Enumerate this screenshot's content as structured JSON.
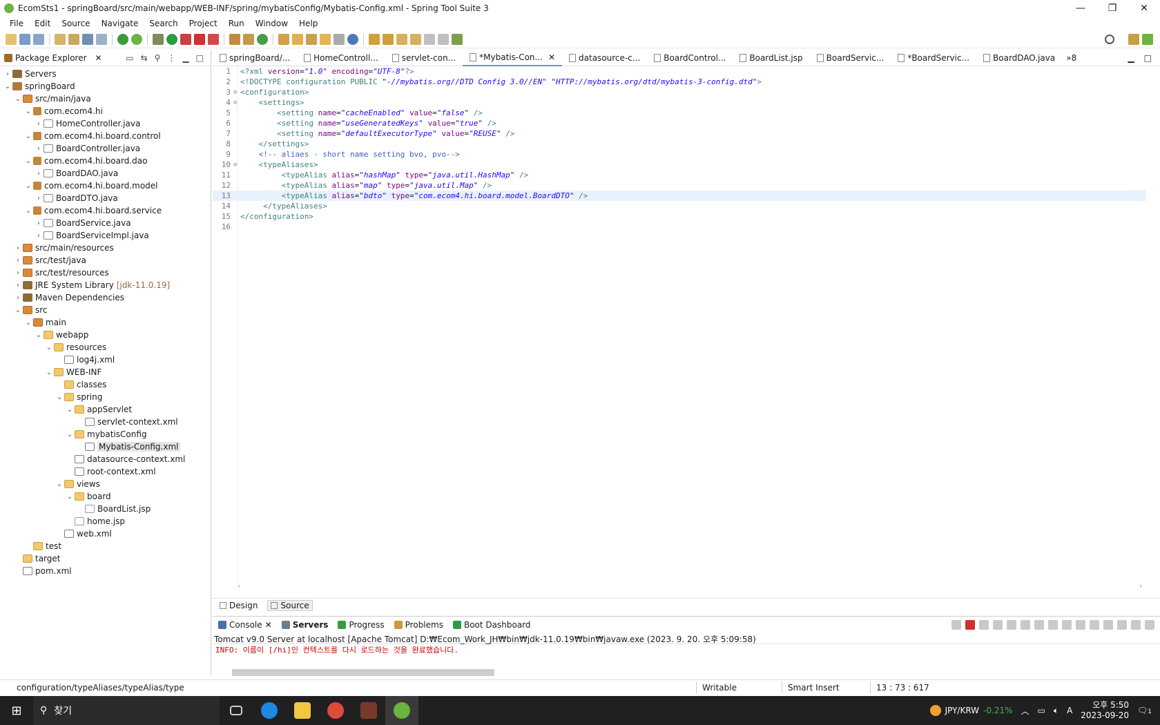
{
  "window": {
    "title": "EcomSts1 - springBoard/src/main/webapp/WEB-INF/spring/mybatisConfig/Mybatis-Config.xml - Spring Tool Suite 3"
  },
  "menu": [
    "File",
    "Edit",
    "Source",
    "Navigate",
    "Search",
    "Project",
    "Run",
    "Window",
    "Help"
  ],
  "package_explorer": {
    "title": "Package Explorer",
    "tree": [
      {
        "label": "Servers",
        "depth": 0,
        "arrow": "›",
        "icon": "server"
      },
      {
        "label": "springBoard",
        "depth": 0,
        "arrow": "⌄",
        "icon": "project"
      },
      {
        "label": "src/main/java",
        "depth": 1,
        "arrow": "⌄",
        "icon": "src"
      },
      {
        "label": "com.ecom4.hi",
        "depth": 2,
        "arrow": "⌄",
        "icon": "pkg"
      },
      {
        "label": "HomeController.java",
        "depth": 3,
        "arrow": "›",
        "icon": "java"
      },
      {
        "label": "com.ecom4.hi.board.control",
        "depth": 2,
        "arrow": "⌄",
        "icon": "pkg"
      },
      {
        "label": "BoardController.java",
        "depth": 3,
        "arrow": "›",
        "icon": "java"
      },
      {
        "label": "com.ecom4.hi.board.dao",
        "depth": 2,
        "arrow": "⌄",
        "icon": "pkg"
      },
      {
        "label": "BoardDAO.java",
        "depth": 3,
        "arrow": "›",
        "icon": "java"
      },
      {
        "label": "com.ecom4.hi.board.model",
        "depth": 2,
        "arrow": "⌄",
        "icon": "pkg"
      },
      {
        "label": "BoardDTO.java",
        "depth": 3,
        "arrow": "›",
        "icon": "java"
      },
      {
        "label": "com.ecom4.hi.board.service",
        "depth": 2,
        "arrow": "⌄",
        "icon": "pkg"
      },
      {
        "label": "BoardService.java",
        "depth": 3,
        "arrow": "›",
        "icon": "java"
      },
      {
        "label": "BoardServiceImpl.java",
        "depth": 3,
        "arrow": "›",
        "icon": "java"
      },
      {
        "label": "src/main/resources",
        "depth": 1,
        "arrow": "›",
        "icon": "src"
      },
      {
        "label": "src/test/java",
        "depth": 1,
        "arrow": "›",
        "icon": "src"
      },
      {
        "label": "src/test/resources",
        "depth": 1,
        "arrow": "›",
        "icon": "src"
      },
      {
        "label": "JRE System Library",
        "depth": 1,
        "arrow": "›",
        "icon": "lib",
        "suffix": "[jdk-11.0.19]"
      },
      {
        "label": "Maven Dependencies",
        "depth": 1,
        "arrow": "›",
        "icon": "lib"
      },
      {
        "label": "src",
        "depth": 1,
        "arrow": "⌄",
        "icon": "src"
      },
      {
        "label": "main",
        "depth": 2,
        "arrow": "⌄",
        "icon": "src"
      },
      {
        "label": "webapp",
        "depth": 3,
        "arrow": "⌄",
        "icon": "folder"
      },
      {
        "label": "resources",
        "depth": 4,
        "arrow": "⌄",
        "icon": "folder"
      },
      {
        "label": "log4j.xml",
        "depth": 5,
        "arrow": "",
        "icon": "xml"
      },
      {
        "label": "WEB-INF",
        "depth": 4,
        "arrow": "⌄",
        "icon": "folder"
      },
      {
        "label": "classes",
        "depth": 5,
        "arrow": "",
        "icon": "folder"
      },
      {
        "label": "spring",
        "depth": 5,
        "arrow": "⌄",
        "icon": "folder"
      },
      {
        "label": "appServlet",
        "depth": 6,
        "arrow": "⌄",
        "icon": "folder"
      },
      {
        "label": "servlet-context.xml",
        "depth": 7,
        "arrow": "",
        "icon": "xml"
      },
      {
        "label": "mybatisConfig",
        "depth": 6,
        "arrow": "⌄",
        "icon": "folder"
      },
      {
        "label": "Mybatis-Config.xml",
        "depth": 7,
        "arrow": "",
        "icon": "xml",
        "selected": true
      },
      {
        "label": "datasource-context.xml",
        "depth": 6,
        "arrow": "",
        "icon": "xml"
      },
      {
        "label": "root-context.xml",
        "depth": 6,
        "arrow": "",
        "icon": "xml"
      },
      {
        "label": "views",
        "depth": 5,
        "arrow": "⌄",
        "icon": "folder"
      },
      {
        "label": "board",
        "depth": 6,
        "arrow": "⌄",
        "icon": "folder"
      },
      {
        "label": "BoardList.jsp",
        "depth": 7,
        "arrow": "",
        "icon": "jsp"
      },
      {
        "label": "home.jsp",
        "depth": 6,
        "arrow": "",
        "icon": "jsp"
      },
      {
        "label": "web.xml",
        "depth": 5,
        "arrow": "",
        "icon": "xml"
      },
      {
        "label": "test",
        "depth": 2,
        "arrow": "",
        "icon": "folder"
      },
      {
        "label": "target",
        "depth": 1,
        "arrow": "",
        "icon": "folder"
      },
      {
        "label": "pom.xml",
        "depth": 1,
        "arrow": "",
        "icon": "xml"
      }
    ]
  },
  "editor_tabs": [
    {
      "label": "springBoard/...",
      "active": false
    },
    {
      "label": "HomeControll...",
      "active": false
    },
    {
      "label": "servlet-con...",
      "active": false
    },
    {
      "label": "*Mybatis-Con...",
      "active": true
    },
    {
      "label": "datasource-c...",
      "active": false
    },
    {
      "label": "BoardControl...",
      "active": false
    },
    {
      "label": "BoardList.jsp",
      "active": false
    },
    {
      "label": "BoardServic...",
      "active": false
    },
    {
      "label": "*BoardServic...",
      "active": false
    },
    {
      "label": "BoardDAO.java",
      "active": false
    }
  ],
  "editor_more": "»8",
  "code_lines": [
    {
      "n": "1",
      "fold": "",
      "tokens": [
        [
          "t",
          "<?xml "
        ],
        [
          "a",
          "version"
        ],
        [
          "p",
          "="
        ],
        [
          "v",
          "\"1.0\""
        ],
        [
          "p",
          " "
        ],
        [
          "a",
          "encoding"
        ],
        [
          "p",
          "="
        ],
        [
          "v",
          "\"UTF-8\""
        ],
        [
          "t",
          "?>"
        ]
      ]
    },
    {
      "n": "2",
      "fold": "",
      "tokens": [
        [
          "t",
          "<!DOCTYPE configuration PUBLIC "
        ],
        [
          "v",
          "\"-//mybatis.org//DTD Config 3.0//EN\""
        ],
        [
          "p",
          " "
        ],
        [
          "v",
          "\"HTTP://mybatis.org/dtd/mybatis-3-config.dtd\""
        ],
        [
          "t",
          ">"
        ]
      ]
    },
    {
      "n": "3",
      "fold": "⊖",
      "tokens": [
        [
          "t",
          "<configuration>"
        ]
      ]
    },
    {
      "n": "4",
      "fold": "⊖",
      "tokens": [
        [
          "p",
          "    "
        ],
        [
          "t",
          "<settings>"
        ]
      ]
    },
    {
      "n": "5",
      "fold": "",
      "tokens": [
        [
          "p",
          "        "
        ],
        [
          "t",
          "<setting "
        ],
        [
          "a",
          "name"
        ],
        [
          "p",
          "="
        ],
        [
          "v",
          "\"cacheEnabled\""
        ],
        [
          "p",
          " "
        ],
        [
          "a",
          "value"
        ],
        [
          "p",
          "="
        ],
        [
          "v",
          "\"false\""
        ],
        [
          "t",
          " />"
        ]
      ]
    },
    {
      "n": "6",
      "fold": "",
      "tokens": [
        [
          "p",
          "        "
        ],
        [
          "t",
          "<setting "
        ],
        [
          "a",
          "name"
        ],
        [
          "p",
          "="
        ],
        [
          "v",
          "\"useGeneratedKeys\""
        ],
        [
          "p",
          " "
        ],
        [
          "a",
          "value"
        ],
        [
          "p",
          "="
        ],
        [
          "v",
          "\"true\""
        ],
        [
          "t",
          " />"
        ]
      ]
    },
    {
      "n": "7",
      "fold": "",
      "tokens": [
        [
          "p",
          "        "
        ],
        [
          "t",
          "<setting "
        ],
        [
          "a",
          "name"
        ],
        [
          "p",
          "="
        ],
        [
          "v",
          "\"defaultExecutorType\""
        ],
        [
          "p",
          " "
        ],
        [
          "a",
          "value"
        ],
        [
          "p",
          "="
        ],
        [
          "v",
          "\"REUSE\""
        ],
        [
          "t",
          " />"
        ]
      ]
    },
    {
      "n": "8",
      "fold": "",
      "tokens": [
        [
          "p",
          "    "
        ],
        [
          "t",
          "</settings>"
        ]
      ]
    },
    {
      "n": "9",
      "fold": "",
      "tokens": [
        [
          "p",
          "    "
        ],
        [
          "c",
          "<!-- aliaes - short name setting bvo, pvo-->"
        ]
      ]
    },
    {
      "n": "10",
      "fold": "⊖",
      "tokens": [
        [
          "p",
          "    "
        ],
        [
          "t",
          "<typeAliases>"
        ]
      ]
    },
    {
      "n": "11",
      "fold": "",
      "tokens": [
        [
          "p",
          "         "
        ],
        [
          "t",
          "<typeAlias "
        ],
        [
          "a",
          "alias"
        ],
        [
          "p",
          "="
        ],
        [
          "v",
          "\"hashMap\""
        ],
        [
          "p",
          " "
        ],
        [
          "a",
          "type"
        ],
        [
          "p",
          "="
        ],
        [
          "v",
          "\"java.util.HashMap\""
        ],
        [
          "t",
          " />"
        ]
      ]
    },
    {
      "n": "12",
      "fold": "",
      "tokens": [
        [
          "p",
          "         "
        ],
        [
          "t",
          "<typeAlias "
        ],
        [
          "a",
          "alias"
        ],
        [
          "p",
          "="
        ],
        [
          "v",
          "\"map\""
        ],
        [
          "p",
          " "
        ],
        [
          "a",
          "type"
        ],
        [
          "p",
          "="
        ],
        [
          "v",
          "\"java.util.Map\""
        ],
        [
          "t",
          " />"
        ]
      ]
    },
    {
      "n": "13",
      "fold": "",
      "current": true,
      "tokens": [
        [
          "p",
          "         "
        ],
        [
          "t",
          "<typeAlias "
        ],
        [
          "a",
          "alias"
        ],
        [
          "p",
          "="
        ],
        [
          "v",
          "\"bdto\""
        ],
        [
          "p",
          " "
        ],
        [
          "a",
          "type"
        ],
        [
          "p",
          "="
        ],
        [
          "v",
          "\"com.ecom4.hi.board.model.BoardDTO\""
        ],
        [
          "t",
          " />"
        ]
      ]
    },
    {
      "n": "14",
      "fold": "",
      "tokens": [
        [
          "p",
          "     "
        ],
        [
          "t",
          "</typeAliases>"
        ]
      ]
    },
    {
      "n": "15",
      "fold": "",
      "tokens": [
        [
          "t",
          "</configuration>"
        ]
      ]
    },
    {
      "n": "16",
      "fold": "",
      "tokens": []
    }
  ],
  "design_tabs": [
    {
      "label": "Design",
      "active": false
    },
    {
      "label": "Source",
      "active": true
    }
  ],
  "bottom_tabs": [
    {
      "label": "Console",
      "close": "✕",
      "active": false
    },
    {
      "label": "Servers",
      "active": true
    },
    {
      "label": "Progress",
      "active": false
    },
    {
      "label": "Problems",
      "active": false
    },
    {
      "label": "Boot Dashboard",
      "active": false
    }
  ],
  "console": {
    "server_line": "Tomcat v9.0 Server at localhost [Apache Tomcat] D:₩Ecom_Work_JH₩bin₩jdk-11.0.19₩bin₩javaw.exe  (2023. 9. 20. 오후 5:09:58)",
    "info_line": "INFO: 이름이 [/hi]인 컨텍스트를 다시 로드하는 것을 완료했습니다."
  },
  "status": {
    "path": "configuration/typeAliases/typeAlias/type",
    "writable": "Writable",
    "insert_mode": "Smart Insert",
    "position": "13 : 73 : 617"
  },
  "taskbar": {
    "search_label": "찾기",
    "currency": "JPY/KRW",
    "currency_change": "-0.21%",
    "time": "오후 5:50",
    "date": "2023-09-20",
    "notifications": "1",
    "ime": "A"
  }
}
